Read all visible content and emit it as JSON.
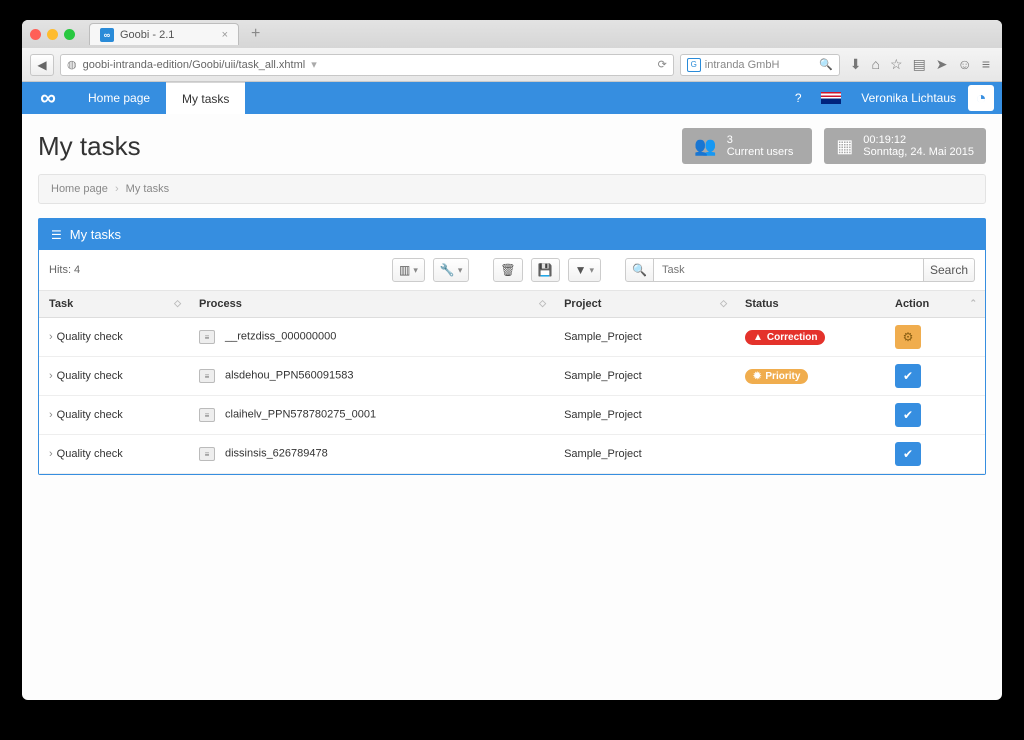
{
  "browser": {
    "tab_title": "Goobi - 2.1",
    "url": "goobi-intranda-edition/Goobi/uii/task_all.xhtml",
    "search_placeholder": "intranda GmbH"
  },
  "appbar": {
    "nav_home": "Home page",
    "nav_tasks": "My tasks",
    "username": "Veronika Lichtaus"
  },
  "page": {
    "title": "My tasks",
    "users_count": "3",
    "users_label": "Current users",
    "clock_time": "00:19:12",
    "clock_date": "Sonntag, 24. Mai 2015",
    "crumb_home": "Home page",
    "crumb_here": "My tasks"
  },
  "panel": {
    "heading": "My tasks",
    "hits_label": "Hits: 4",
    "task_placeholder": "Task",
    "search_btn": "Search"
  },
  "columns": {
    "task": "Task",
    "process": "Process",
    "project": "Project",
    "status": "Status",
    "action": "Action"
  },
  "rows": [
    {
      "task": "Quality check",
      "process": "__retzdiss_000000000",
      "project": "Sample_Project",
      "status_kind": "correction",
      "status_label": "Correction",
      "action_kind": "gear"
    },
    {
      "task": "Quality check",
      "process": "alsdehou_PPN560091583",
      "project": "Sample_Project",
      "status_kind": "priority",
      "status_label": "Priority",
      "action_kind": "check"
    },
    {
      "task": "Quality check",
      "process": "claihelv_PPN578780275_0001",
      "project": "Sample_Project",
      "status_kind": "",
      "status_label": "",
      "action_kind": "check"
    },
    {
      "task": "Quality check",
      "process": "dissinsis_626789478",
      "project": "Sample_Project",
      "status_kind": "",
      "status_label": "",
      "action_kind": "check"
    }
  ]
}
